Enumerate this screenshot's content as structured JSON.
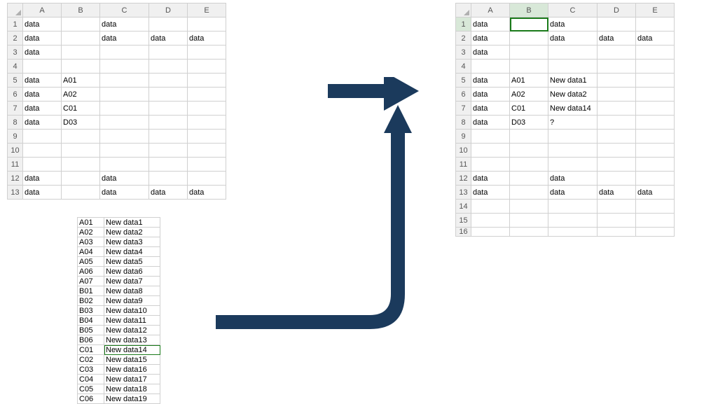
{
  "columns": [
    "A",
    "B",
    "C",
    "D",
    "E"
  ],
  "left_sheet": {
    "rows": [
      {
        "n": "1",
        "A": "data",
        "B": "",
        "C": "data",
        "D": "",
        "E": ""
      },
      {
        "n": "2",
        "A": "data",
        "B": "",
        "C": "data",
        "D": "data",
        "E": "data"
      },
      {
        "n": "3",
        "A": "data",
        "B": "",
        "C": "",
        "D": "",
        "E": ""
      },
      {
        "n": "4",
        "A": "",
        "B": "",
        "C": "",
        "D": "",
        "E": ""
      },
      {
        "n": "5",
        "A": "data",
        "B": "A01",
        "C": "",
        "D": "",
        "E": ""
      },
      {
        "n": "6",
        "A": "data",
        "B": "A02",
        "C": "",
        "D": "",
        "E": ""
      },
      {
        "n": "7",
        "A": "data",
        "B": "C01",
        "C": "",
        "D": "",
        "E": ""
      },
      {
        "n": "8",
        "A": "data",
        "B": "D03",
        "C": "",
        "D": "",
        "E": ""
      },
      {
        "n": "9",
        "A": "",
        "B": "",
        "C": "",
        "D": "",
        "E": ""
      },
      {
        "n": "10",
        "A": "",
        "B": "",
        "C": "",
        "D": "",
        "E": ""
      },
      {
        "n": "11",
        "A": "",
        "B": "",
        "C": "",
        "D": "",
        "E": ""
      },
      {
        "n": "12",
        "A": "data",
        "B": "",
        "C": "data",
        "D": "",
        "E": ""
      },
      {
        "n": "13",
        "A": "data",
        "B": "",
        "C": "data",
        "D": "data",
        "E": "data"
      }
    ]
  },
  "right_sheet": {
    "rows": [
      {
        "n": "1",
        "A": "data",
        "B": "",
        "C": "data",
        "D": "",
        "E": ""
      },
      {
        "n": "2",
        "A": "data",
        "B": "",
        "C": "data",
        "D": "data",
        "E": "data"
      },
      {
        "n": "3",
        "A": "data",
        "B": "",
        "C": "",
        "D": "",
        "E": ""
      },
      {
        "n": "4",
        "A": "",
        "B": "",
        "C": "",
        "D": "",
        "E": ""
      },
      {
        "n": "5",
        "A": "data",
        "B": "A01",
        "C": "New data1",
        "D": "",
        "E": ""
      },
      {
        "n": "6",
        "A": "data",
        "B": "A02",
        "C": "New data2",
        "D": "",
        "E": ""
      },
      {
        "n": "7",
        "A": "data",
        "B": "C01",
        "C": "New data14",
        "D": "",
        "E": ""
      },
      {
        "n": "8",
        "A": "data",
        "B": "D03",
        "C": "?",
        "D": "",
        "E": ""
      },
      {
        "n": "9",
        "A": "",
        "B": "",
        "C": "",
        "D": "",
        "E": ""
      },
      {
        "n": "10",
        "A": "",
        "B": "",
        "C": "",
        "D": "",
        "E": ""
      },
      {
        "n": "11",
        "A": "",
        "B": "",
        "C": "",
        "D": "",
        "E": ""
      },
      {
        "n": "12",
        "A": "data",
        "B": "",
        "C": "data",
        "D": "",
        "E": ""
      },
      {
        "n": "13",
        "A": "data",
        "B": "",
        "C": "data",
        "D": "data",
        "E": "data"
      },
      {
        "n": "14",
        "A": "",
        "B": "",
        "C": "",
        "D": "",
        "E": ""
      },
      {
        "n": "15",
        "A": "",
        "B": "",
        "C": "",
        "D": "",
        "E": ""
      },
      {
        "n": "16",
        "A": "",
        "B": "",
        "C": "",
        "D": "",
        "E": ""
      }
    ],
    "selected_cell": {
      "row": 0,
      "col": "B"
    }
  },
  "lookup_table": {
    "highlight_index": 13,
    "rows": [
      {
        "k": "A01",
        "v": "New data1"
      },
      {
        "k": "A02",
        "v": "New data2"
      },
      {
        "k": "A03",
        "v": "New data3"
      },
      {
        "k": "A04",
        "v": "New data4"
      },
      {
        "k": "A05",
        "v": "New data5"
      },
      {
        "k": "A06",
        "v": "New data6"
      },
      {
        "k": "A07",
        "v": "New data7"
      },
      {
        "k": "B01",
        "v": "New data8"
      },
      {
        "k": "B02",
        "v": "New data9"
      },
      {
        "k": "B03",
        "v": "New data10"
      },
      {
        "k": "B04",
        "v": "New data11"
      },
      {
        "k": "B05",
        "v": "New data12"
      },
      {
        "k": "B06",
        "v": "New data13"
      },
      {
        "k": "C01",
        "v": "New data14"
      },
      {
        "k": "C02",
        "v": "New data15"
      },
      {
        "k": "C03",
        "v": "New data16"
      },
      {
        "k": "C04",
        "v": "New data17"
      },
      {
        "k": "C05",
        "v": "New data18"
      },
      {
        "k": "C06",
        "v": "New data19"
      }
    ]
  },
  "arrow_color": "#1b3a5c"
}
